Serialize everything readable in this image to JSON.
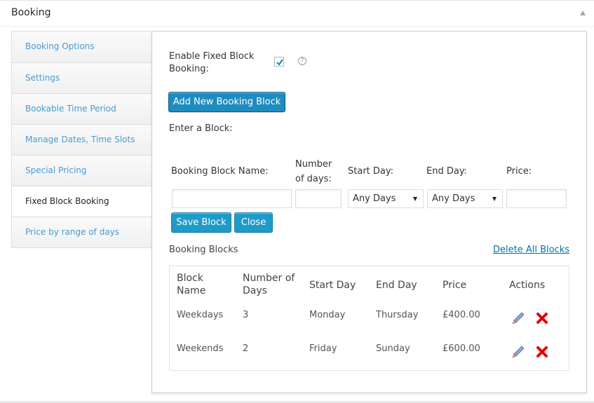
{
  "postbox": {
    "title": "Booking",
    "toggle_icon": "triangle-up-icon"
  },
  "tabs": [
    {
      "label": "Booking Options",
      "active": false
    },
    {
      "label": "Settings",
      "active": false
    },
    {
      "label": "Bookable Time Period",
      "active": false
    },
    {
      "label": "Manage Dates, Time Slots",
      "active": false
    },
    {
      "label": "Special Pricing",
      "active": false
    },
    {
      "label": "Fixed Block Booking",
      "active": true
    },
    {
      "label": "Price by range of days",
      "active": false
    }
  ],
  "panel": {
    "enable_label": "Enable Fixed Block Booking:",
    "enable_checked": true,
    "help_icon": "?",
    "add_button": "Add New Booking Block",
    "enter_block_label": "Enter a Block:",
    "form": {
      "name_label": "Booking Block Name:",
      "days_label_1": "Number",
      "days_label_2": "of days:",
      "start_label": "Start Day:",
      "end_label": "End Day:",
      "price_label": "Price:",
      "name_value": "",
      "days_value": "",
      "start_value": "Any Days",
      "end_value": "Any Days",
      "price_value": "",
      "save_button": "Save Block",
      "close_button": "Close"
    },
    "blocks_label": "Booking Blocks",
    "delete_all": "Delete All Blocks",
    "table": {
      "headers": {
        "name_1": "Block",
        "name_2": "Name",
        "days_1": "Number of",
        "days_2": "Days",
        "start": "Start Day",
        "end": "End Day",
        "price": "Price",
        "actions": "Actions"
      },
      "rows": [
        {
          "name": "Weekdays",
          "days": "3",
          "start": "Monday",
          "end": "Thursday",
          "price": "£400.00"
        },
        {
          "name": "Weekends",
          "days": "2",
          "start": "Friday",
          "end": "Sunday",
          "price": "£600.00"
        }
      ]
    }
  }
}
